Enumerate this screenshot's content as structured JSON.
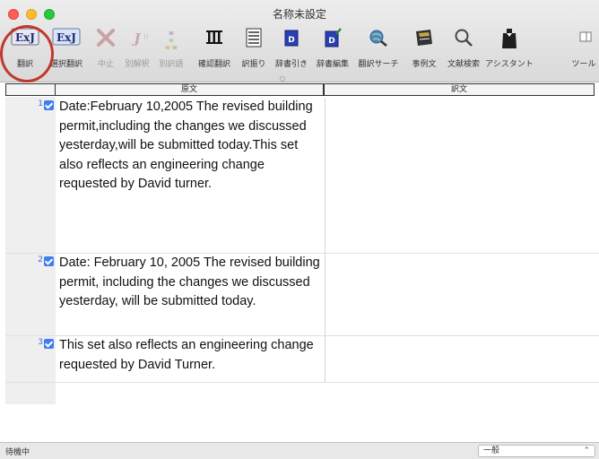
{
  "window": {
    "title": "名称未設定"
  },
  "toolbar": {
    "buttons": [
      {
        "label": "翻訳",
        "icon": "ej-translate-icon",
        "enabled": true
      },
      {
        "label": "選択翻訳",
        "icon": "ej-select-translate-icon",
        "enabled": true
      },
      {
        "label": "中止",
        "icon": "stop-x-icon",
        "enabled": false
      },
      {
        "label": "別解釈",
        "icon": "alt-interpretation-icon",
        "enabled": false
      },
      {
        "label": "別訳語",
        "icon": "alt-word-icon",
        "enabled": false
      },
      {
        "label": "確認翻訳",
        "icon": "verify-translate-icon",
        "enabled": true
      },
      {
        "label": "訳振り",
        "icon": "interlinear-icon",
        "enabled": true
      },
      {
        "label": "辞書引き",
        "icon": "dictionary-lookup-icon",
        "enabled": true
      },
      {
        "label": "辞書編集",
        "icon": "dictionary-edit-icon",
        "enabled": true
      },
      {
        "label": "翻訳サーチ",
        "icon": "translate-search-icon",
        "enabled": true
      },
      {
        "label": "事例文",
        "icon": "example-sentence-icon",
        "enabled": true
      },
      {
        "label": "文献検索",
        "icon": "literature-search-icon",
        "enabled": true
      },
      {
        "label": "アシスタント",
        "icon": "assistant-icon",
        "enabled": true
      },
      {
        "label": "ツール",
        "icon": "tools-icon",
        "enabled": true
      }
    ]
  },
  "table": {
    "headers": {
      "source": "原文",
      "target": "訳文"
    },
    "rows": [
      {
        "num": "1",
        "source": "Date:February 10,2005 The revised building permit,including the changes we discussed yesterday,will be submitted today.This set also reflects an engineering change requested by David turner.",
        "target": ""
      },
      {
        "num": "2",
        "source": "Date: February 10, 2005 The revised building permit, including the changes we discussed yesterday, will be submitted today.",
        "target": ""
      },
      {
        "num": "3",
        "source": "This set also reflects an engineering change requested by David Turner.",
        "target": ""
      }
    ]
  },
  "status": {
    "text": "待機中",
    "mode": "一般"
  },
  "colors": {
    "accent": "#3f7ef1",
    "highlight_ring": "#c0392b"
  }
}
